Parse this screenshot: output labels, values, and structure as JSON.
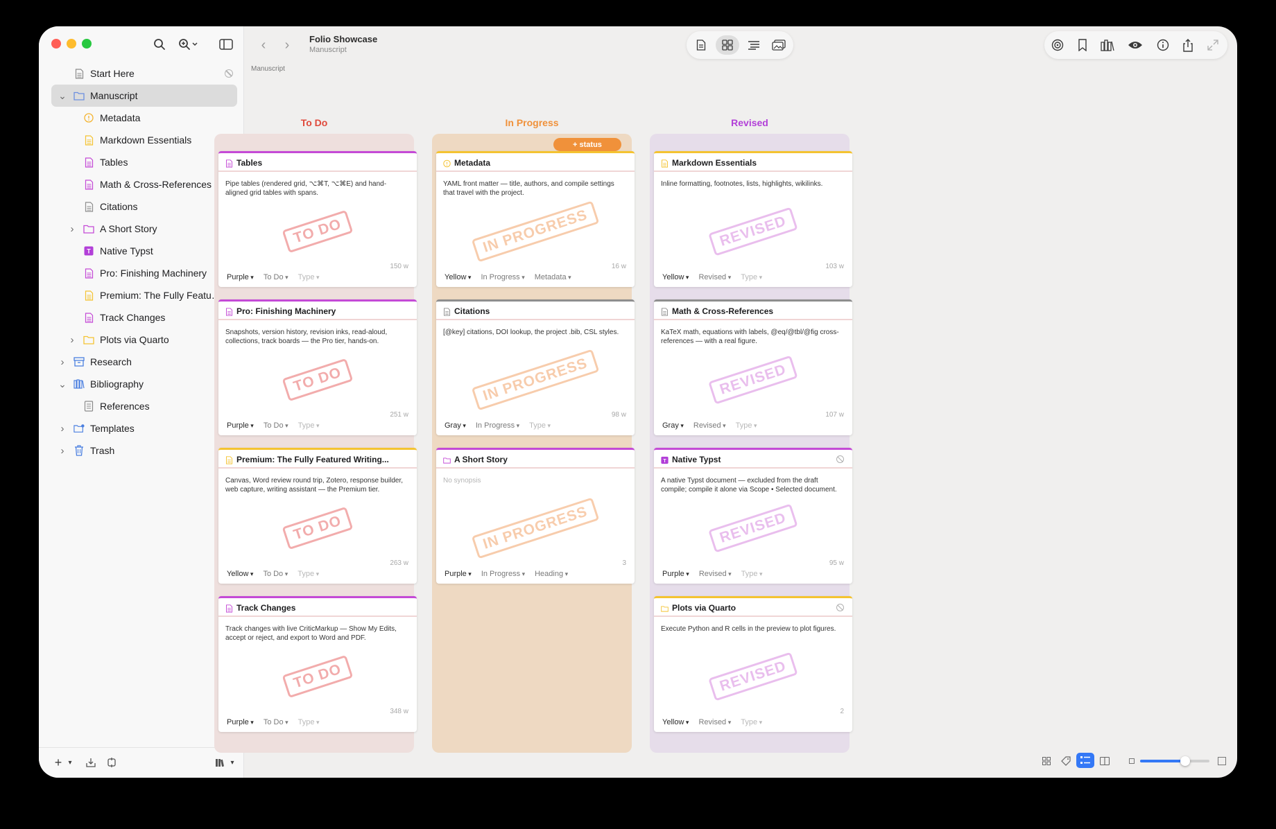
{
  "window": {
    "colors": {
      "accent": "#3478f6",
      "todo": "#e04a3c",
      "in_progress": "#f0913a",
      "revised": "#b23fd8"
    }
  },
  "sidebar": {
    "items": [
      {
        "label": "Start Here",
        "icon": "document-icon",
        "level": 0,
        "chevron": false,
        "noexport": true
      },
      {
        "label": "Manuscript",
        "icon": "folder-icon",
        "level": 0,
        "chevron": "open",
        "selected": true
      },
      {
        "label": "Metadata",
        "icon": "metadata-icon",
        "level": 1
      },
      {
        "label": "Markdown Essentials",
        "icon": "document-icon",
        "level": 1
      },
      {
        "label": "Tables",
        "icon": "document-icon",
        "level": 1
      },
      {
        "label": "Math & Cross-References",
        "icon": "document-icon",
        "level": 1
      },
      {
        "label": "Citations",
        "icon": "document-icon",
        "level": 1
      },
      {
        "label": "A Short Story",
        "icon": "folder-icon",
        "level": 1,
        "chevron": "closed"
      },
      {
        "label": "Native Typst",
        "icon": "typst-icon",
        "level": 1,
        "noexport": true
      },
      {
        "label": "Pro: Finishing Machinery",
        "icon": "document-icon",
        "level": 1
      },
      {
        "label": "Premium: The Fully Feature...",
        "icon": "document-icon",
        "level": 1
      },
      {
        "label": "Track Changes",
        "icon": "document-icon",
        "level": 1
      },
      {
        "label": "Plots via Quarto",
        "icon": "folder-icon",
        "level": 1,
        "chevron": "closed",
        "noexport": true
      },
      {
        "label": "Research",
        "icon": "archive-icon",
        "level": 0,
        "chevron": "closed"
      },
      {
        "label": "Bibliography",
        "icon": "library-icon",
        "level": 0,
        "chevron": "open"
      },
      {
        "label": "References",
        "icon": "references-icon",
        "level": 1
      },
      {
        "label": "Templates",
        "icon": "templates-folder-icon",
        "level": 0,
        "chevron": "closed"
      },
      {
        "label": "Trash",
        "icon": "trash-icon",
        "level": 0,
        "chevron": "closed",
        "noexport": true
      }
    ]
  },
  "header": {
    "title": "Folio Showcase",
    "subtitle": "Manuscript",
    "breadcrumb": "Manuscript"
  },
  "board": {
    "add_status_label": "+ status",
    "columns": [
      {
        "title": "To Do",
        "color": "#e04a3c",
        "bg": "#eedfdd",
        "stamp": "TO DO",
        "stamp_color": "#e86a6a"
      },
      {
        "title": "In Progress",
        "color": "#f0913a",
        "bg": "#eed9c2",
        "stamp": "IN PROGRESS",
        "stamp_color": "#f2a46a"
      },
      {
        "title": "Revised",
        "color": "#b23fd8",
        "bg": "#e6ddea",
        "stamp": "REVISED",
        "stamp_color": "#d88ae0"
      }
    ],
    "cards": [
      {
        "col": 0,
        "row": 0,
        "title": "Tables",
        "synopsis": "Pipe tables (rendered grid, ⌥⌘T, ⌥⌘E) and hand-aligned grid tables with spans.",
        "words": "150 w",
        "label": "Purple",
        "status": "To Do",
        "type": "Type",
        "bar": "#c44ad6",
        "icon_color": "#c44ad6"
      },
      {
        "col": 0,
        "row": 1,
        "title": "Pro: Finishing Machinery",
        "synopsis": "Snapshots, version history, revision inks, read-aloud, collections, track boards — the Pro tier, hands-on.",
        "words": "251 w",
        "label": "Purple",
        "status": "To Do",
        "type": "Type",
        "bar": "#c44ad6",
        "icon_color": "#c44ad6"
      },
      {
        "col": 0,
        "row": 2,
        "title": "Premium: The Fully Featured Writing...",
        "synopsis": "Canvas, Word review round trip, Zotero, response builder, web capture, writing assistant — the Premium tier.",
        "words": "263 w",
        "label": "Yellow",
        "status": "To Do",
        "type": "Type",
        "bar": "#f4c331",
        "icon_color": "#f4c331"
      },
      {
        "col": 0,
        "row": 3,
        "title": "Track Changes",
        "synopsis": "Track changes with live CriticMarkup — Show My Edits, accept or reject, and export to Word and PDF.",
        "words": "348 w",
        "label": "Purple",
        "status": "To Do",
        "type": "Type",
        "bar": "#c44ad6",
        "icon_color": "#c44ad6"
      },
      {
        "col": 1,
        "row": 0,
        "title": "Metadata",
        "synopsis": "YAML front matter — title, authors, and compile settings that travel with the project.",
        "words": "16 w",
        "label": "Yellow",
        "status": "In Progress",
        "type": "Metadata",
        "bar": "#f4c331",
        "icon_color": "#f4c331"
      },
      {
        "col": 1,
        "row": 1,
        "title": "Citations",
        "synopsis": "[@key] citations, DOI lookup, the project .bib, CSL styles.",
        "words": "98 w",
        "label": "Gray",
        "status": "In Progress",
        "type": "Type",
        "bar": "#8e8e8e",
        "icon_color": "#8e8e8e"
      },
      {
        "col": 1,
        "row": 2,
        "title": "A Short Story",
        "synopsis": "No synopsis",
        "empty": true,
        "words": "3",
        "label": "Purple",
        "status": "In Progress",
        "type": "Heading",
        "bar": "#c44ad6",
        "icon_color": "#c44ad6"
      },
      {
        "col": 2,
        "row": 0,
        "title": "Markdown Essentials",
        "synopsis": "Inline formatting, footnotes, lists, highlights, wikilinks.",
        "words": "103 w",
        "label": "Yellow",
        "status": "Revised",
        "type": "Type",
        "bar": "#f4c331",
        "icon_color": "#f4c331"
      },
      {
        "col": 2,
        "row": 1,
        "title": "Math & Cross-References",
        "synopsis": "KaTeX math, equations with labels, @eq/@tbl/@fig cross-references — with a real figure.",
        "words": "107 w",
        "label": "Gray",
        "status": "Revised",
        "type": "Type",
        "bar": "#8e8e8e",
        "icon_color": "#8e8e8e"
      },
      {
        "col": 2,
        "row": 2,
        "title": "Native Typst",
        "synopsis": "A native Typst document — excluded from the draft compile; compile it alone via Scope • Selected document.",
        "words": "95 w",
        "label": "Purple",
        "status": "Revised",
        "type": "Type",
        "bar": "#c44ad6",
        "icon_color": "#b23fd8",
        "noexport": true
      },
      {
        "col": 2,
        "row": 3,
        "title": "Plots via Quarto",
        "synopsis": "Execute Python and R cells in the preview to plot figures.",
        "words": "2",
        "label": "Yellow",
        "status": "Revised",
        "type": "Type",
        "bar": "#f4c331",
        "icon_color": "#f4c331",
        "noexport": true
      }
    ]
  },
  "zoom_slider": {
    "value": 0.65
  }
}
